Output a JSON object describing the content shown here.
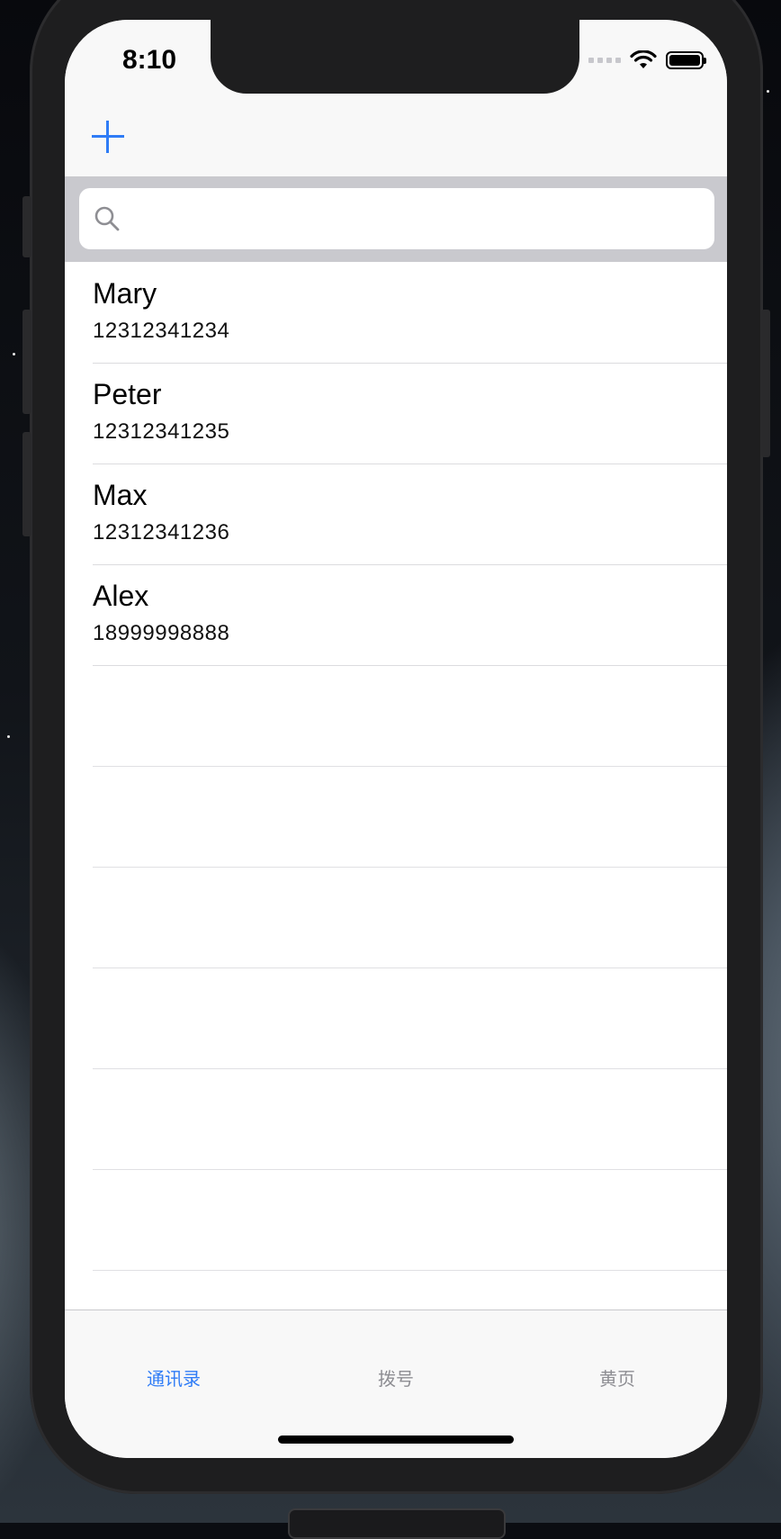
{
  "status_bar": {
    "time": "8:10"
  },
  "navbar": {
    "add_label": ""
  },
  "search": {
    "placeholder": ""
  },
  "contacts": [
    {
      "name": "Mary",
      "phone": "12312341234"
    },
    {
      "name": "Peter",
      "phone": "12312341235"
    },
    {
      "name": "Max",
      "phone": "12312341236"
    },
    {
      "name": "Alex",
      "phone": "18999998888"
    }
  ],
  "tabs": [
    {
      "label": "通讯录",
      "active": true
    },
    {
      "label": "拨号",
      "active": false
    },
    {
      "label": "黄页",
      "active": false
    }
  ],
  "colors": {
    "accent": "#2f7cf6",
    "inactive_tab": "#8e8e93",
    "search_bg": "#c9c9ce"
  },
  "icons": {
    "add": "plus-icon",
    "search": "search-icon",
    "wifi": "wifi-icon",
    "battery": "battery-icon"
  }
}
